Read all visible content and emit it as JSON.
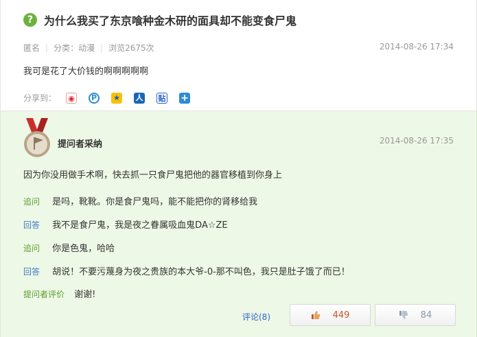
{
  "question": {
    "icon": "question-mark-icon",
    "title": "为什么我买了东京喰种金木研的面具却不能变食尸鬼",
    "author": "匿名",
    "category": "分类：动漫",
    "views": "浏览2675次",
    "time": "2014-08-26 17:34",
    "body": "我可是花了大价钱的啊啊啊啊啊"
  },
  "share": {
    "label": "分享到：",
    "icons": [
      "weibo-icon",
      "qzone-icon",
      "qq-weibo-icon",
      "renren-icon",
      "tieba-icon",
      "more-share-icon"
    ]
  },
  "answer": {
    "adopted_label": "提问者采纳",
    "time": "2014-08-26 17:35",
    "body": "因为你没用做手术啊，快去抓一只食尸鬼把他的器官移植到你身上",
    "thread": [
      {
        "tag": "追问",
        "text": "是吗，靴靴。你是食尸鬼吗，能不能把你的肾移给我"
      },
      {
        "tag": "回答",
        "text": "我不是食尸鬼，我是夜之眷属吸血鬼DA☆ZE"
      },
      {
        "tag": "追问",
        "text": "你是色鬼，哈哈"
      },
      {
        "tag": "回答",
        "text": "胡说！不要污蔑身为夜之贵族的本大爷-0-那不叫色，我只是肚子饿了而已！"
      }
    ],
    "rating_tag": "提问者评价",
    "rating_text": "谢谢!",
    "comment_link": "评论(8)",
    "upvotes": "449",
    "downvotes": "84"
  },
  "colors": {
    "accent_green": "#6cb33e",
    "answer_bg": "#eef8e6",
    "link_blue": "#2a63c9",
    "upvote_color": "#c3582a"
  }
}
